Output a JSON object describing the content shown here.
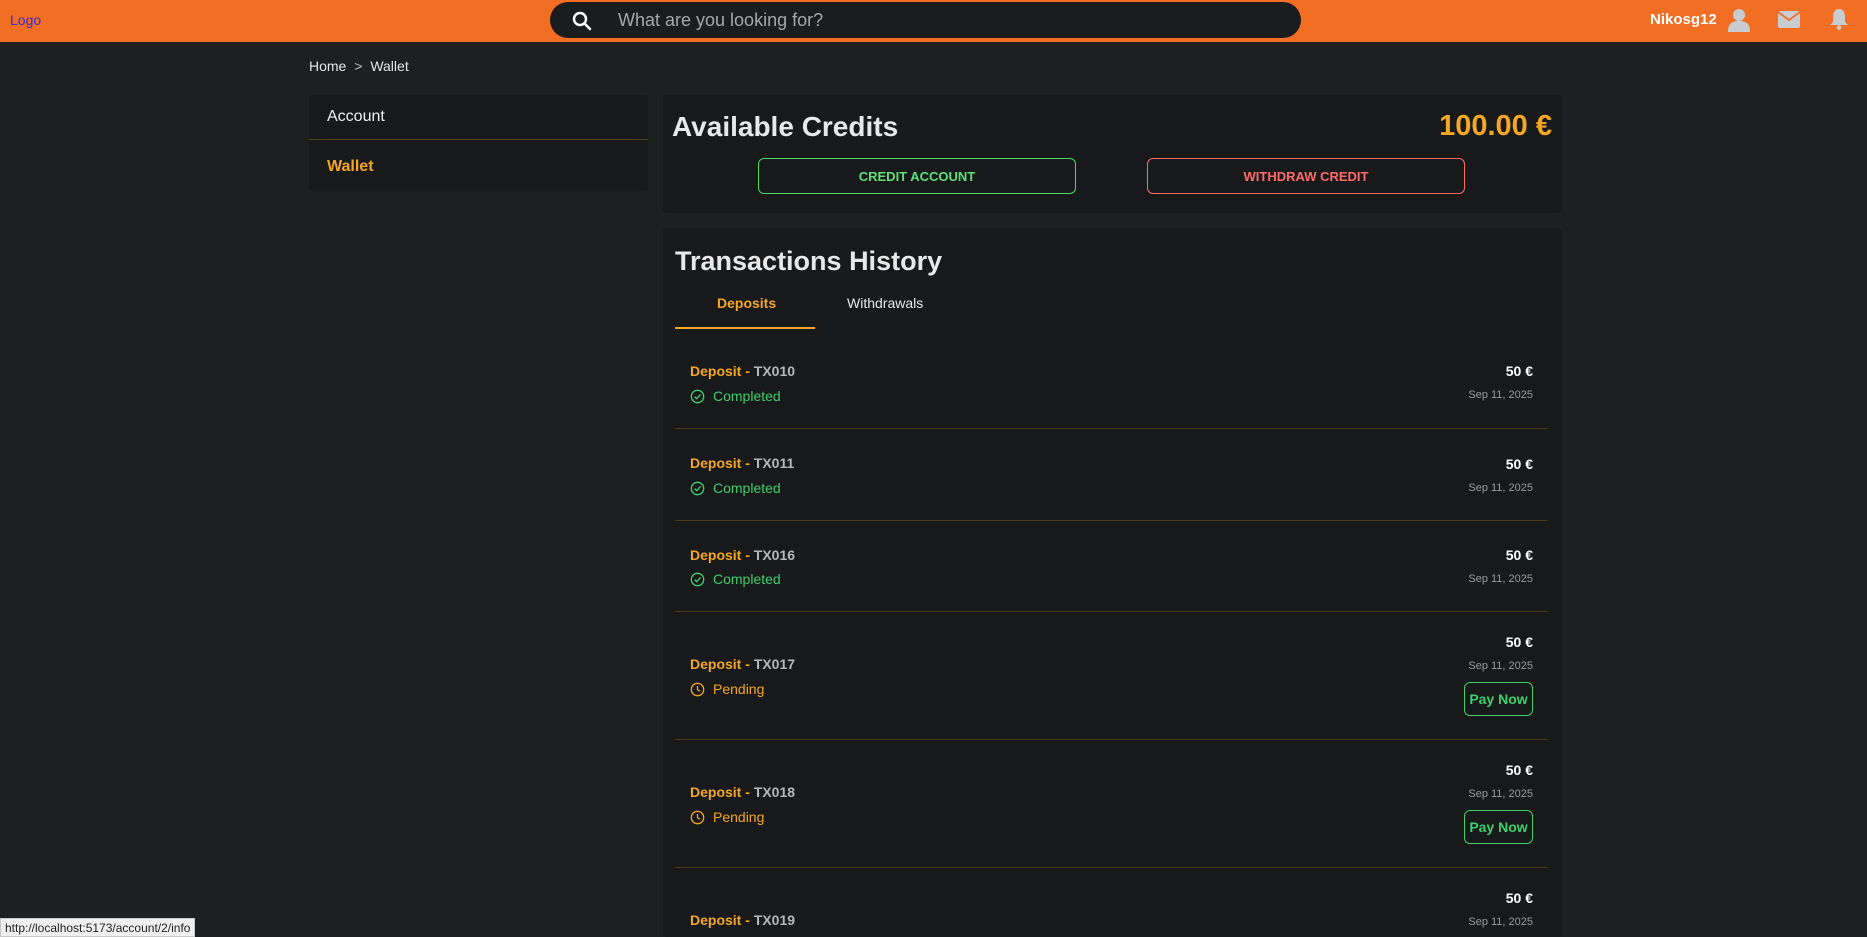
{
  "header": {
    "logo": "Logo",
    "search_placeholder": "What are you looking for?",
    "username": "Nikosg12",
    "icons": [
      "search-icon",
      "user-icon",
      "mail-icon",
      "bell-icon"
    ],
    "accent_color": "#f26e22"
  },
  "breadcrumb": {
    "home": "Home",
    "separator": ">",
    "current": "Wallet"
  },
  "sidebar": {
    "items": [
      {
        "label": "Account"
      },
      {
        "label": "Wallet"
      }
    ]
  },
  "credits": {
    "title": "Available Credits",
    "amount": "100.00 €",
    "credit_button": "CREDIT ACCOUNT",
    "withdraw_button": "WITHDRAW CREDIT"
  },
  "transactions": {
    "title": "Transactions History",
    "tabs": [
      {
        "label": "Deposits"
      },
      {
        "label": "Withdrawals"
      }
    ],
    "rows": [
      {
        "label": "Deposit -",
        "id": "TX010",
        "status": "Completed",
        "amount": "50 €",
        "date": "Sep 11, 2025"
      },
      {
        "label": "Deposit -",
        "id": "TX011",
        "status": "Completed",
        "amount": "50 €",
        "date": "Sep 11, 2025"
      },
      {
        "label": "Deposit -",
        "id": "TX016",
        "status": "Completed",
        "amount": "50 €",
        "date": "Sep 11, 2025"
      },
      {
        "label": "Deposit -",
        "id": "TX017",
        "status": "Pending",
        "amount": "50 €",
        "date": "Sep 11, 2025",
        "action": "Pay Now"
      },
      {
        "label": "Deposit -",
        "id": "TX018",
        "status": "Pending",
        "amount": "50 €",
        "date": "Sep 11, 2025",
        "action": "Pay Now"
      },
      {
        "label": "Deposit -",
        "id": "TX019",
        "amount": "50 €",
        "date": "Sep 11, 2025"
      }
    ]
  },
  "status_bar": {
    "url": "http://localhost:5173/account/2/info"
  }
}
